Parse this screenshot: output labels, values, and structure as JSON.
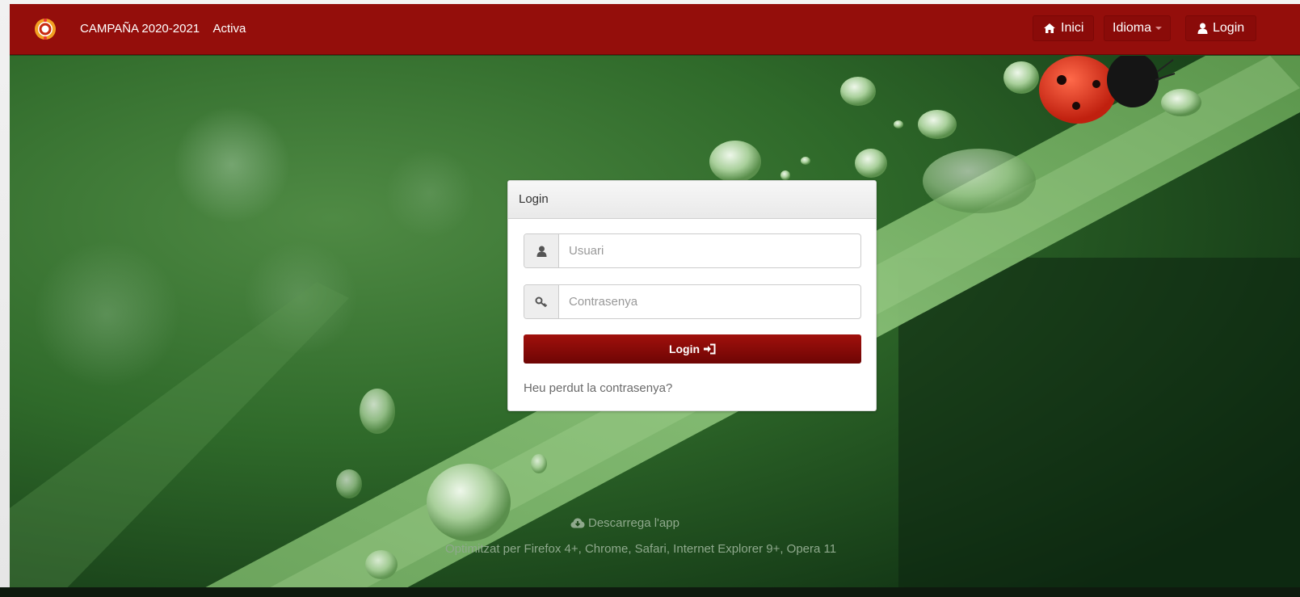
{
  "navbar": {
    "campaign": "CAMPAÑA 2020-2021",
    "status": "Activa",
    "home_label": "Inici",
    "language_label": "Idioma",
    "login_label": "Login",
    "color": "#940e0b"
  },
  "login_panel": {
    "title": "Login",
    "username_placeholder": "Usuari",
    "password_placeholder": "Contrasenya",
    "submit_label": "Login",
    "forgot_password": "Heu perdut la contrasenya?"
  },
  "footer": {
    "download_app": "Descarrega l'app",
    "optimized": "Optimitzat per Firefox 4+, Chrome, Safari, Internet Explorer 9+, Opera 11"
  },
  "icons": [
    "logo-icon",
    "home-icon",
    "user-icon",
    "key-icon",
    "sign-in-icon",
    "cloud-download-icon"
  ]
}
